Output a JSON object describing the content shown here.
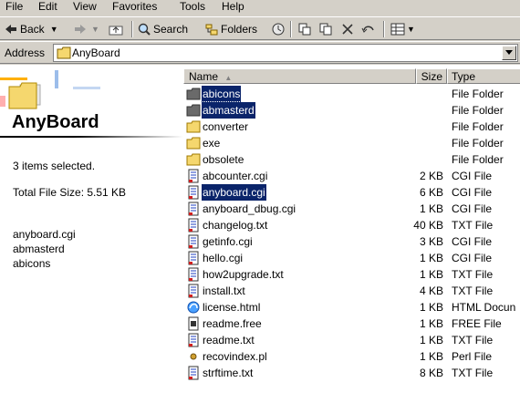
{
  "menu": [
    "File",
    "Edit",
    "View",
    "Favorites",
    "Tools",
    "Help"
  ],
  "toolbar": {
    "back_label": "Back",
    "search_label": "Search",
    "folders_label": "Folders"
  },
  "address": {
    "label": "Address",
    "value": "AnyBoard"
  },
  "left_pane": {
    "title": "AnyBoard",
    "selection_info": "3 items selected.",
    "total_size": "Total File Size: 5.51 KB",
    "selected_items": [
      "anyboard.cgi",
      "abmasterd",
      "abicons"
    ]
  },
  "columns": {
    "name": "Name",
    "size": "Size",
    "type": "Type"
  },
  "files": [
    {
      "name": "abicons",
      "size": "",
      "type": "File Folder",
      "icon": "folder-dark-icon",
      "selected": true
    },
    {
      "name": "abmasterd",
      "size": "",
      "type": "File Folder",
      "icon": "folder-dark-icon",
      "selected": true
    },
    {
      "name": "converter",
      "size": "",
      "type": "File Folder",
      "icon": "folder-icon",
      "selected": false
    },
    {
      "name": "exe",
      "size": "",
      "type": "File Folder",
      "icon": "folder-icon",
      "selected": false
    },
    {
      "name": "obsolete",
      "size": "",
      "type": "File Folder",
      "icon": "folder-icon",
      "selected": false
    },
    {
      "name": "abcounter.cgi",
      "size": "2 KB",
      "type": "CGI File",
      "icon": "script-file-icon",
      "selected": false
    },
    {
      "name": "anyboard.cgi",
      "size": "6 KB",
      "type": "CGI File",
      "icon": "script-file-icon",
      "selected": true
    },
    {
      "name": "anyboard_dbug.cgi",
      "size": "1 KB",
      "type": "CGI File",
      "icon": "script-file-icon",
      "selected": false
    },
    {
      "name": "changelog.txt",
      "size": "40 KB",
      "type": "TXT File",
      "icon": "script-file-icon",
      "selected": false
    },
    {
      "name": "getinfo.cgi",
      "size": "3 KB",
      "type": "CGI File",
      "icon": "script-file-icon",
      "selected": false
    },
    {
      "name": "hello.cgi",
      "size": "1 KB",
      "type": "CGI File",
      "icon": "script-file-icon",
      "selected": false
    },
    {
      "name": "how2upgrade.txt",
      "size": "1 KB",
      "type": "TXT File",
      "icon": "script-file-icon",
      "selected": false
    },
    {
      "name": "install.txt",
      "size": "4 KB",
      "type": "TXT File",
      "icon": "script-file-icon",
      "selected": false
    },
    {
      "name": "license.html",
      "size": "1 KB",
      "type": "HTML Docun",
      "icon": "ie-html-icon",
      "selected": false
    },
    {
      "name": "readme.free",
      "size": "1 KB",
      "type": "FREE File",
      "icon": "generic-file-icon",
      "selected": false
    },
    {
      "name": "readme.txt",
      "size": "1 KB",
      "type": "TXT File",
      "icon": "script-file-icon",
      "selected": false
    },
    {
      "name": "recovindex.pl",
      "size": "1 KB",
      "type": "Perl File",
      "icon": "perl-file-icon",
      "selected": false
    },
    {
      "name": "strftime.txt",
      "size": "8 KB",
      "type": "TXT File",
      "icon": "script-file-icon",
      "selected": false
    }
  ],
  "colors": {
    "selection": "#0a246a",
    "face": "#d4d0c8",
    "folder": "#f5d76e"
  }
}
